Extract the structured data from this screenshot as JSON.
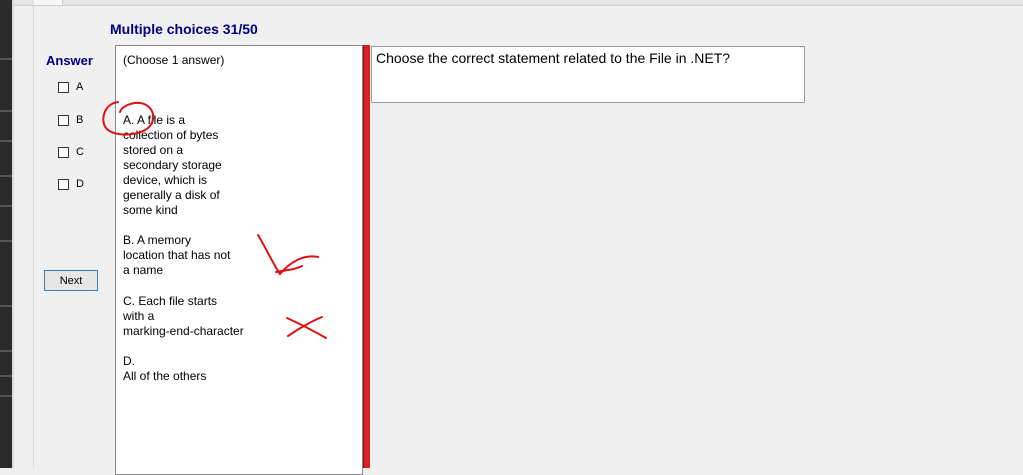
{
  "header": {
    "title": "Multiple choices 31/50"
  },
  "answer_panel": {
    "label": "Answer",
    "options": [
      "A",
      "B",
      "C",
      "D"
    ],
    "next_label": "Next"
  },
  "answers": {
    "instruction": "(Choose 1 answer)",
    "a": "A.  A file is a\ncollection of bytes\nstored on a\nsecondary storage\ndevice, which is\ngenerally a disk of\nsome kind",
    "b": "B.  A memory\nlocation that has not\na name",
    "c": "C.  Each file starts\nwith a\nmarking-end-character",
    "d": "D.\n All of the others"
  },
  "question": {
    "text": "Choose the correct statement related to the File in .NET?"
  },
  "colors": {
    "accent": "#000080",
    "annotation": "#e01010",
    "splitter": "#d91f1f"
  }
}
